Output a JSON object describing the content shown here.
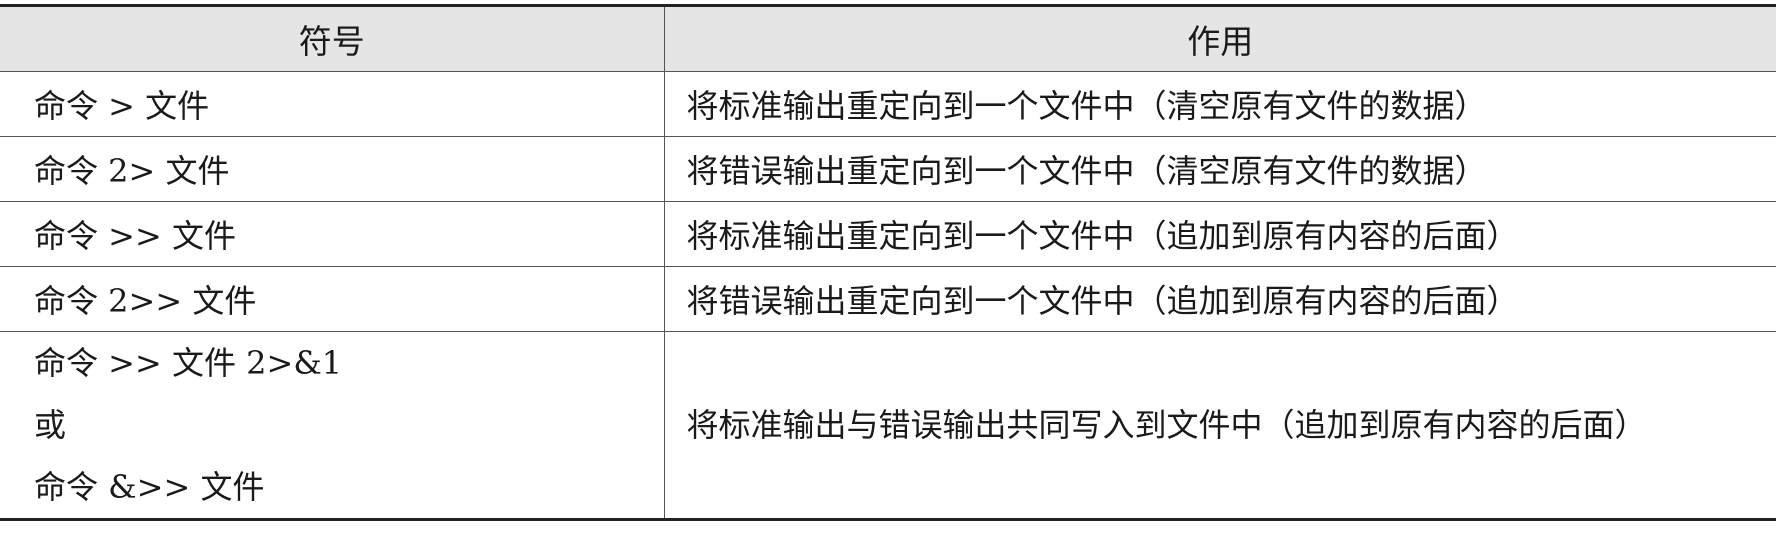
{
  "table": {
    "headers": [
      "符号",
      "作用"
    ],
    "rows": [
      {
        "symbol": "命令 > 文件",
        "effect": "将标准输出重定向到一个文件中（清空原有文件的数据）"
      },
      {
        "symbol": "命令 2> 文件",
        "effect": "将错误输出重定向到一个文件中（清空原有文件的数据）"
      },
      {
        "symbol": "命令 >> 文件",
        "effect": "将标准输出重定向到一个文件中（追加到原有内容的后面）"
      },
      {
        "symbol": "命令 2>> 文件",
        "effect": "将错误输出重定向到一个文件中（追加到原有内容的后面）"
      }
    ],
    "last_row": {
      "symbol_lines": [
        "命令 >> 文件 2>&1",
        "或",
        "命令 &>> 文件"
      ],
      "effect": "将标准输出与错误输出共同写入到文件中（追加到原有内容的后面）"
    }
  }
}
